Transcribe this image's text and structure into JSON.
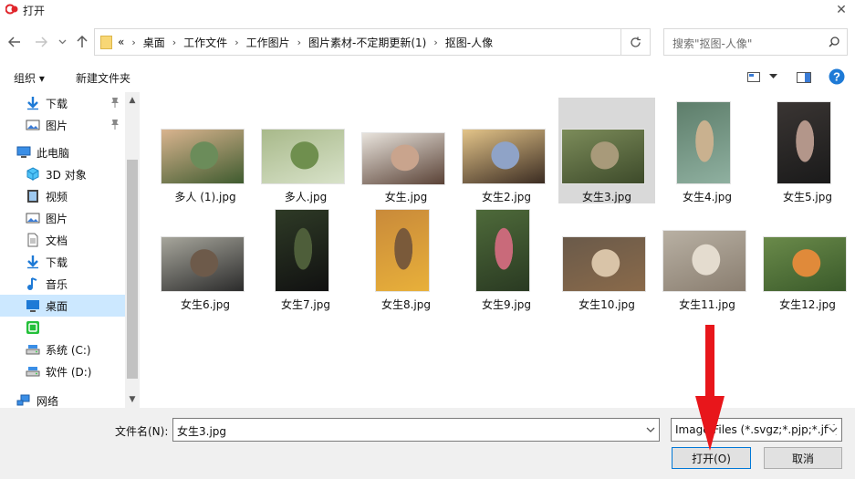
{
  "window": {
    "title": "打开",
    "close_glyph": "✕"
  },
  "nav": {
    "back_icon": "arrow-left-icon",
    "forward_icon": "arrow-right-icon",
    "recent_icon": "chevron-down-icon",
    "up_icon": "arrow-up-icon"
  },
  "address": {
    "overflow": "«",
    "crumbs": [
      "桌面",
      "工作文件",
      "工作图片",
      "图片素材-不定期更新(1)",
      "抠图-人像"
    ],
    "separator": "›"
  },
  "search": {
    "placeholder": "搜索\"抠图-人像\""
  },
  "toolbar": {
    "organize_label": "组织 ▾",
    "new_folder_label": "新建文件夹"
  },
  "sidebar": {
    "items": [
      {
        "label": "下载",
        "icon": "download-icon",
        "pinned": true
      },
      {
        "label": "图片",
        "icon": "pictures-icon",
        "pinned": true
      },
      {
        "label": "此电脑",
        "icon": "computer-icon",
        "pinned": false
      },
      {
        "label": "3D 对象",
        "icon": "3d-objects-icon",
        "pinned": false
      },
      {
        "label": "视频",
        "icon": "video-icon",
        "pinned": false
      },
      {
        "label": "图片",
        "icon": "pictures-icon",
        "pinned": false
      },
      {
        "label": "文档",
        "icon": "documents-icon",
        "pinned": false
      },
      {
        "label": "下载",
        "icon": "download-icon",
        "pinned": false
      },
      {
        "label": "音乐",
        "icon": "music-icon",
        "pinned": false
      },
      {
        "label": "桌面",
        "icon": "desktop-icon",
        "pinned": false,
        "selected": true
      },
      {
        "label": "",
        "icon": "app-icon",
        "pinned": false
      },
      {
        "label": "系统 (C:)",
        "icon": "drive-icon",
        "pinned": false
      },
      {
        "label": "软件 (D:)",
        "icon": "drive-icon",
        "pinned": false
      },
      {
        "label": "网络",
        "icon": "network-icon",
        "pinned": false
      }
    ]
  },
  "files": [
    {
      "name": "多人 (1).jpg",
      "colors": [
        "#d9b48f",
        "#6b8c5a",
        "#3f5b2f"
      ]
    },
    {
      "name": "多人.jpg",
      "colors": [
        "#a8b98a",
        "#6f8f4e",
        "#d8e2c9"
      ]
    },
    {
      "name": "女生.jpg",
      "colors": [
        "#e8e3dc",
        "#c9a48d",
        "#5a4236"
      ]
    },
    {
      "name": "女生2.jpg",
      "colors": [
        "#e3c489",
        "#8fa3c7",
        "#3b2c22"
      ]
    },
    {
      "name": "女生3.jpg",
      "colors": [
        "#7c8c5a",
        "#a89a7a",
        "#3d4a2a"
      ],
      "selected": true
    },
    {
      "name": "女生4.jpg",
      "colors": [
        "#5d7d6a",
        "#c9b18f",
        "#8fb0a0"
      ]
    },
    {
      "name": "女生5.jpg",
      "colors": [
        "#3a3533",
        "#b3968a",
        "#1a1a1a"
      ]
    },
    {
      "name": "女生6.jpg",
      "colors": [
        "#a7a69c",
        "#6d5a4a",
        "#2b2b2b"
      ]
    },
    {
      "name": "女生7.jpg",
      "colors": [
        "#2e3a26",
        "#4e5e3a",
        "#111111"
      ]
    },
    {
      "name": "女生8.jpg",
      "colors": [
        "#c98a3a",
        "#7a5a3a",
        "#e8b03a"
      ]
    },
    {
      "name": "女生9.jpg",
      "colors": [
        "#4e6a3a",
        "#c96a7a",
        "#2a3a22"
      ]
    },
    {
      "name": "女生10.jpg",
      "colors": [
        "#6a5a4a",
        "#d9c4a8",
        "#8a6a4a"
      ]
    },
    {
      "name": "女生11.jpg",
      "colors": [
        "#b8b0a3",
        "#e4dccf",
        "#8a7e70"
      ]
    },
    {
      "name": "女生12.jpg",
      "colors": [
        "#6a8a4a",
        "#e08a3a",
        "#3a5a2a"
      ]
    }
  ],
  "bottom": {
    "filename_label": "文件名(N):",
    "filename_value": "女生3.jpg",
    "filetype_value": "Image Files (*.svgz;*.pjp;*.jfif;",
    "open_label": "打开(O)",
    "cancel_label": "取消"
  },
  "colors": {
    "selection": "#cce8ff",
    "selected_tile": "#d9d9d9",
    "annotation_arrow": "#e8161b",
    "help_icon": "#1e7ad6"
  }
}
